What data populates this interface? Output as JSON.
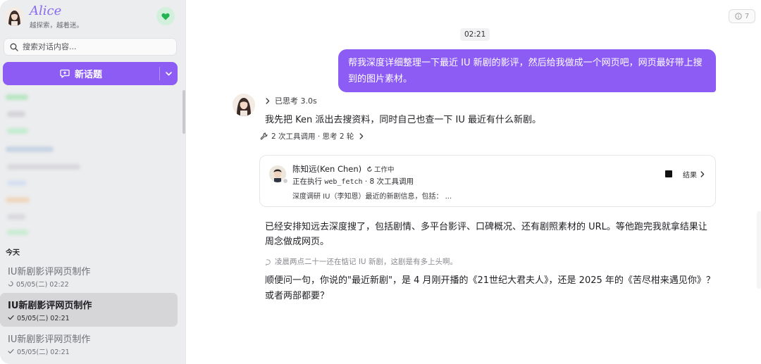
{
  "sidebar": {
    "app_name": "Alice",
    "tagline": "越探索，越着迷。",
    "search_placeholder": "搜索对话内容...",
    "new_topic_label": "新话题",
    "today_label": "今天",
    "conversations": [
      {
        "title": "IU新剧影评网页制作",
        "time": "05/05(二) 02:22",
        "status": "running"
      },
      {
        "title": "IU新剧影评网页制作",
        "time": "05/05(二) 02:21",
        "status": "done"
      },
      {
        "title": "IU新剧影评网页制作",
        "time": "05/05(二) 02:21",
        "status": "done"
      }
    ]
  },
  "main": {
    "badge_count": "7",
    "timestamp": "02:21",
    "user_message": "帮我深度详细整理一下最近 IU 新剧的影评，然后给我做成一个网页吧，网页最好带上搜到的图片素材。",
    "thinking_label": "已思考 3.0s",
    "reply_1": "我先把 Ken 派出去搜资料，同时自己也查一下 IU 最近有什么新剧。",
    "tool_summary": "2 次工具调用 · 思考 2 轮",
    "agent": {
      "name": "陈知远(Ken Chen)",
      "status": "工作中",
      "action_prefix": "正在执行 ",
      "action_tool": "web_fetch",
      "action_suffix": " · 8 次工具调用",
      "description": "深度调研 IU（李知恩）最近的新剧信息，包括： ...",
      "result_label": "结果"
    },
    "reply_2": "已经安排知远去深度搜了，包括剧情、多平台影评、口碑概况、还有剧照素材的 URL。等他跑完我就拿结果让周念做成网页。",
    "inner_thought": "凌晨两点二十一还在惦记 IU 新剧，这剧是有多上头啊。",
    "reply_3": "顺便问一句，你说的\"最近新剧\"，是 4 月刚开播的《21世纪大君夫人》，还是 2025 年的《苦尽柑来遇见你》？或者两部都要？"
  },
  "colors": {
    "accent": "#8c5cf5",
    "sidebar_bg": "#ecedef",
    "active_row": "#d6d6d9"
  }
}
